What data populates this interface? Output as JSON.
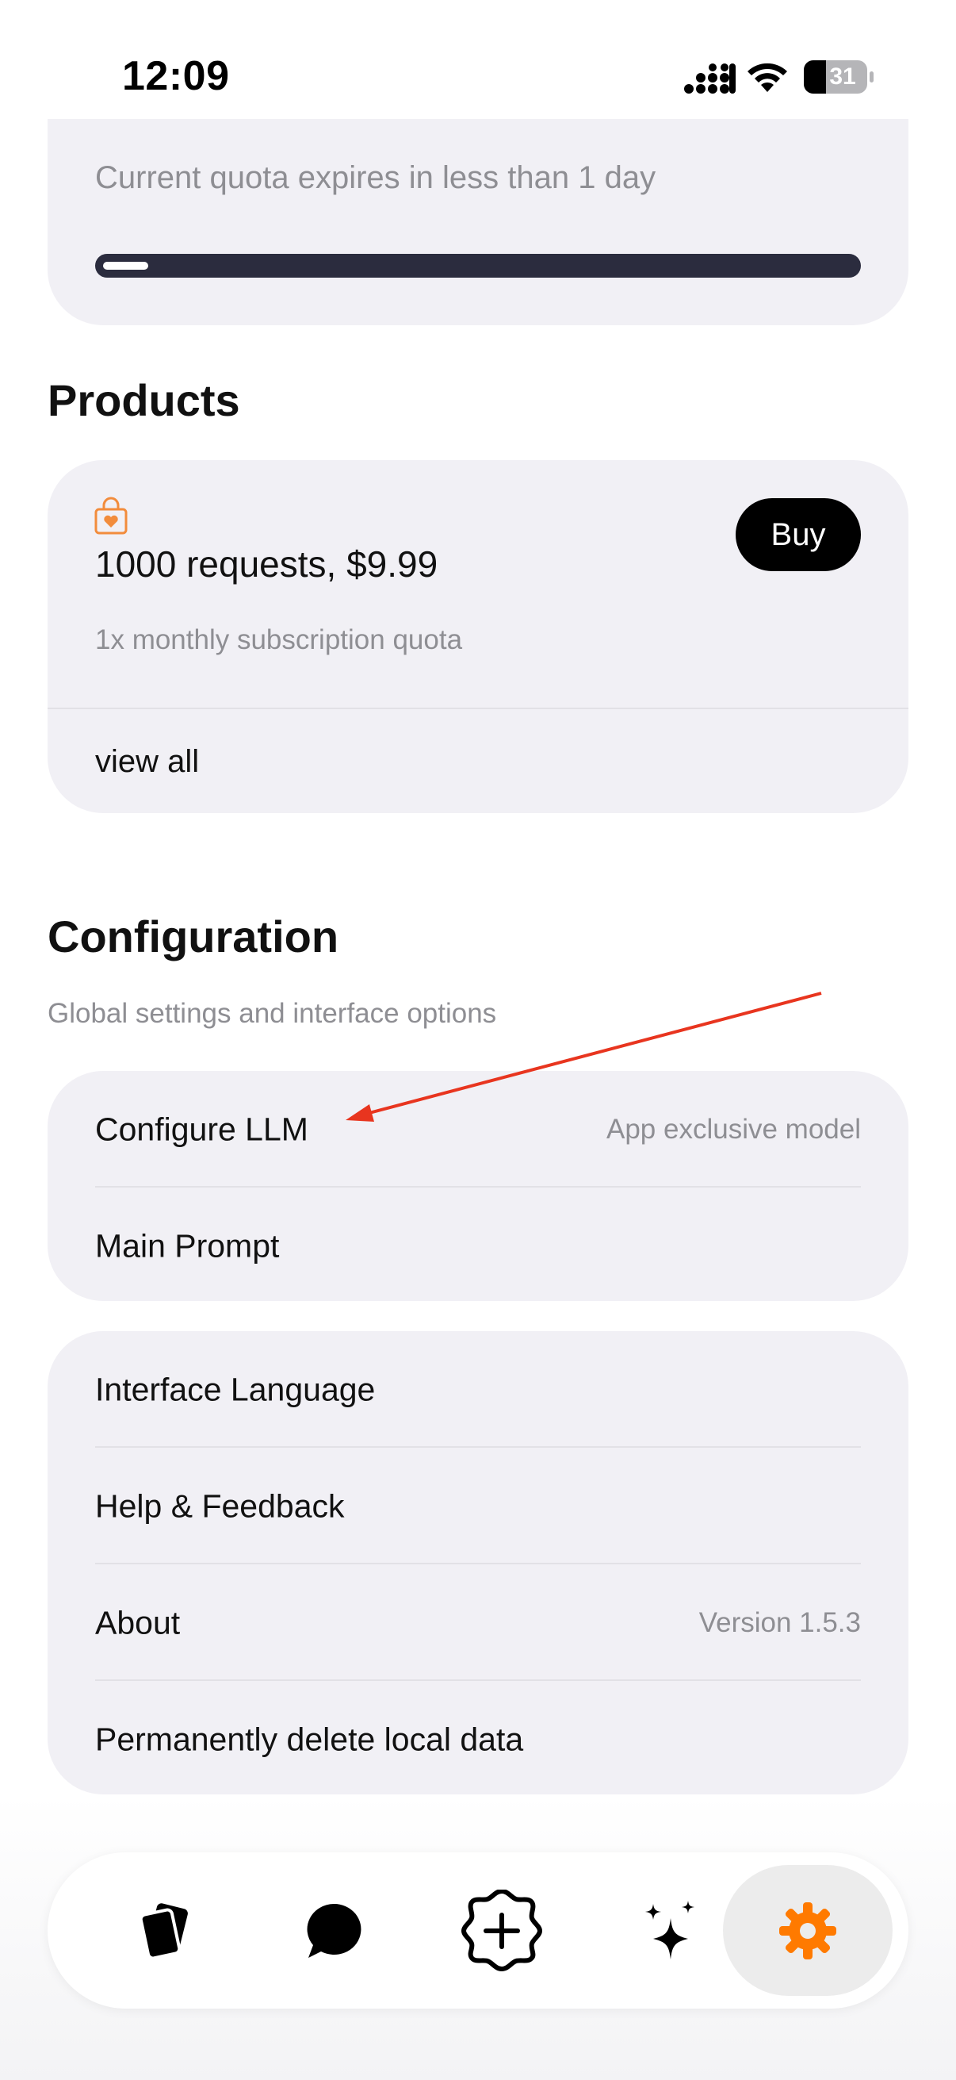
{
  "status_bar": {
    "time": "12:09",
    "battery": "31"
  },
  "quota": {
    "expires_text": "Current quota expires in less than 1 day",
    "progress_fraction": 0.06
  },
  "products": {
    "title": "Products",
    "item_title": "1000 requests, $9.99",
    "item_subtitle": "1x monthly subscription quota",
    "buy_label": "Buy",
    "view_all_label": "view all"
  },
  "configuration": {
    "title": "Configuration",
    "subtitle": "Global settings and interface options",
    "group1": [
      {
        "label": "Configure LLM",
        "value": "App exclusive model"
      },
      {
        "label": "Main Prompt",
        "value": ""
      }
    ],
    "group2": [
      {
        "label": "Interface Language",
        "value": ""
      },
      {
        "label": "Help & Feedback",
        "value": ""
      },
      {
        "label": "About",
        "value": "Version 1.5.3"
      },
      {
        "label": "Permanently delete local data",
        "value": ""
      }
    ]
  },
  "tabbar": {
    "tabs": [
      {
        "icon": "cards-icon",
        "active": false
      },
      {
        "icon": "chat-bubble-icon",
        "active": false
      },
      {
        "icon": "add-badge-icon",
        "active": false
      },
      {
        "icon": "sparkles-icon",
        "active": false
      },
      {
        "icon": "gear-icon",
        "active": true
      }
    ]
  },
  "colors": {
    "accent": "#ff7a00",
    "annotation_arrow": "#e8351f",
    "card_bg": "#f1f0f5"
  }
}
